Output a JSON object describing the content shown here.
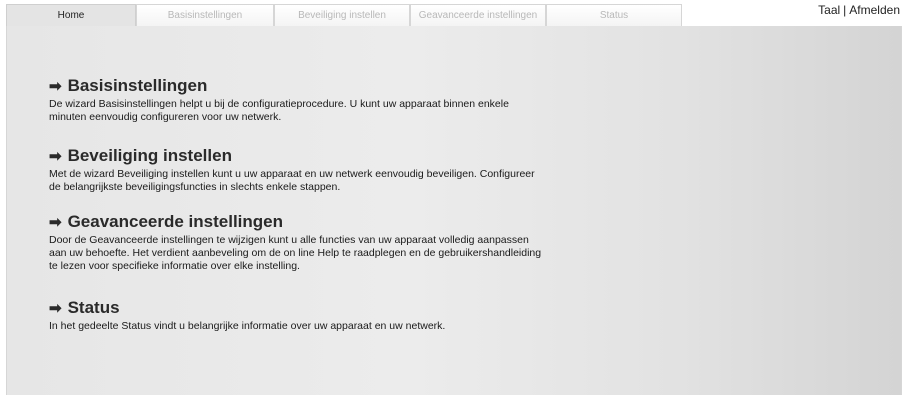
{
  "tabs": [
    {
      "label": "Home",
      "active": true
    },
    {
      "label": "Basisinstellingen",
      "active": false
    },
    {
      "label": "Beveiliging instellen",
      "active": false
    },
    {
      "label": "Geavanceerde instellingen",
      "active": false
    },
    {
      "label": "Status",
      "active": false
    }
  ],
  "top_links": {
    "language": "Taal",
    "separator": "|",
    "logout": "Afmelden"
  },
  "sections": [
    {
      "arrow": "➡",
      "title": "Basisinstellingen",
      "text": "De wizard Basisinstellingen helpt u bij de configuratieprocedure. U kunt uw apparaat binnen enkele minuten eenvoudig configureren voor uw netwerk."
    },
    {
      "arrow": "➡",
      "title": "Beveiliging instellen",
      "text": "Met de wizard Beveiliging instellen kunt u uw apparaat en uw netwerk eenvoudig beveiligen. Configureer de belangrijkste beveiligingsfuncties in slechts enkele stappen."
    },
    {
      "arrow": "➡",
      "title": "Geavanceerde instellingen",
      "text": "Door de Geavanceerde instellingen te wijzigen kunt u alle functies van uw apparaat volledig aanpassen aan uw behoefte. Het verdient aanbeveling om de on line Help te raadplegen en de gebruikershandleiding te lezen voor specifieke informatie over elke instelling."
    },
    {
      "arrow": "➡",
      "title": "Status",
      "text": "In het gedeelte Status vindt u belangrijke informatie over uw apparaat en uw netwerk."
    }
  ],
  "icons": {
    "section_arrow": "right-arrow-icon"
  }
}
